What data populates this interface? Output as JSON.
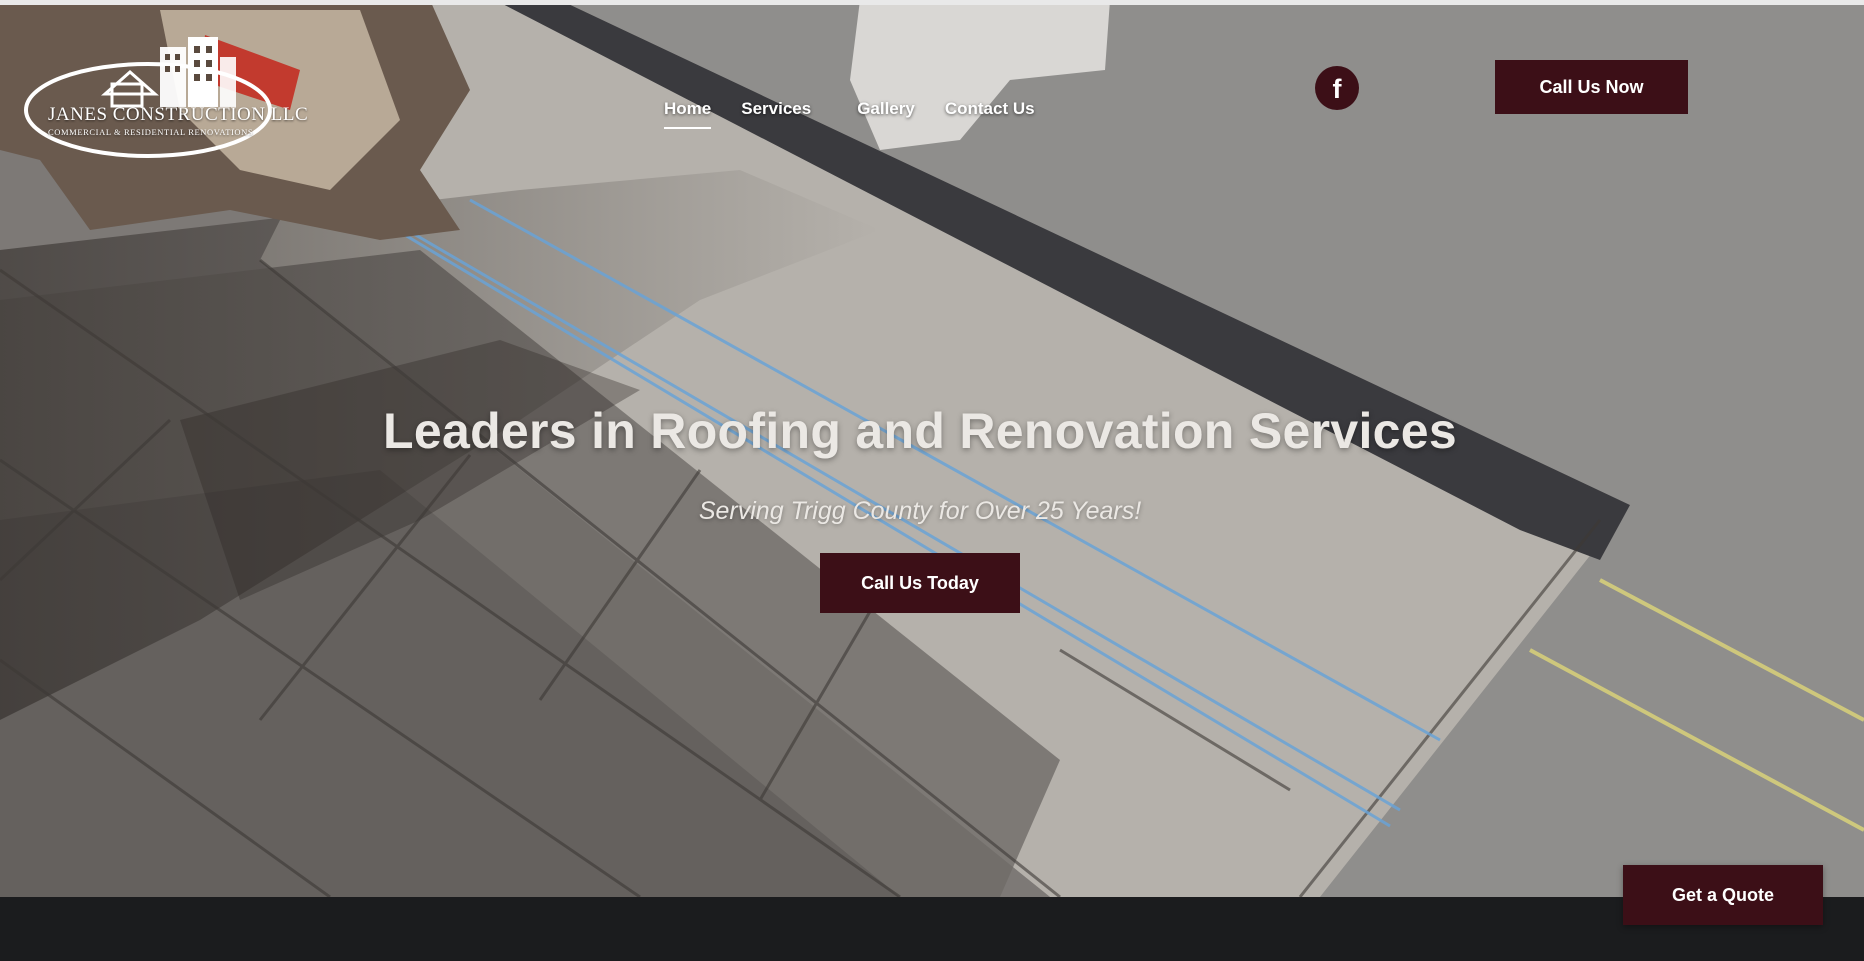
{
  "header": {
    "logo": {
      "name": "JANES CONSTRUCTION LLC",
      "tagline": "COMMERCIAL & RESIDENTIAL RENOVATIONS"
    },
    "nav": [
      {
        "label": "Home",
        "active": true
      },
      {
        "label": "Services",
        "has_dropdown": true
      },
      {
        "label": "Gallery"
      },
      {
        "label": "Contact Us"
      }
    ],
    "social": {
      "icon": "facebook-icon",
      "glyph": "f"
    },
    "cta_label": "Call Us Now"
  },
  "hero": {
    "title": "Leaders in Roofing and Renovation Services",
    "subtitle": "Serving Trigg County for Over 25 Years!",
    "cta_label": "Call Us Today"
  },
  "floating_cta": {
    "label": "Get a Quote"
  },
  "colors": {
    "brand": "#3c0f17",
    "text_light": "#ffffff",
    "footer": "#1b1c1e"
  }
}
